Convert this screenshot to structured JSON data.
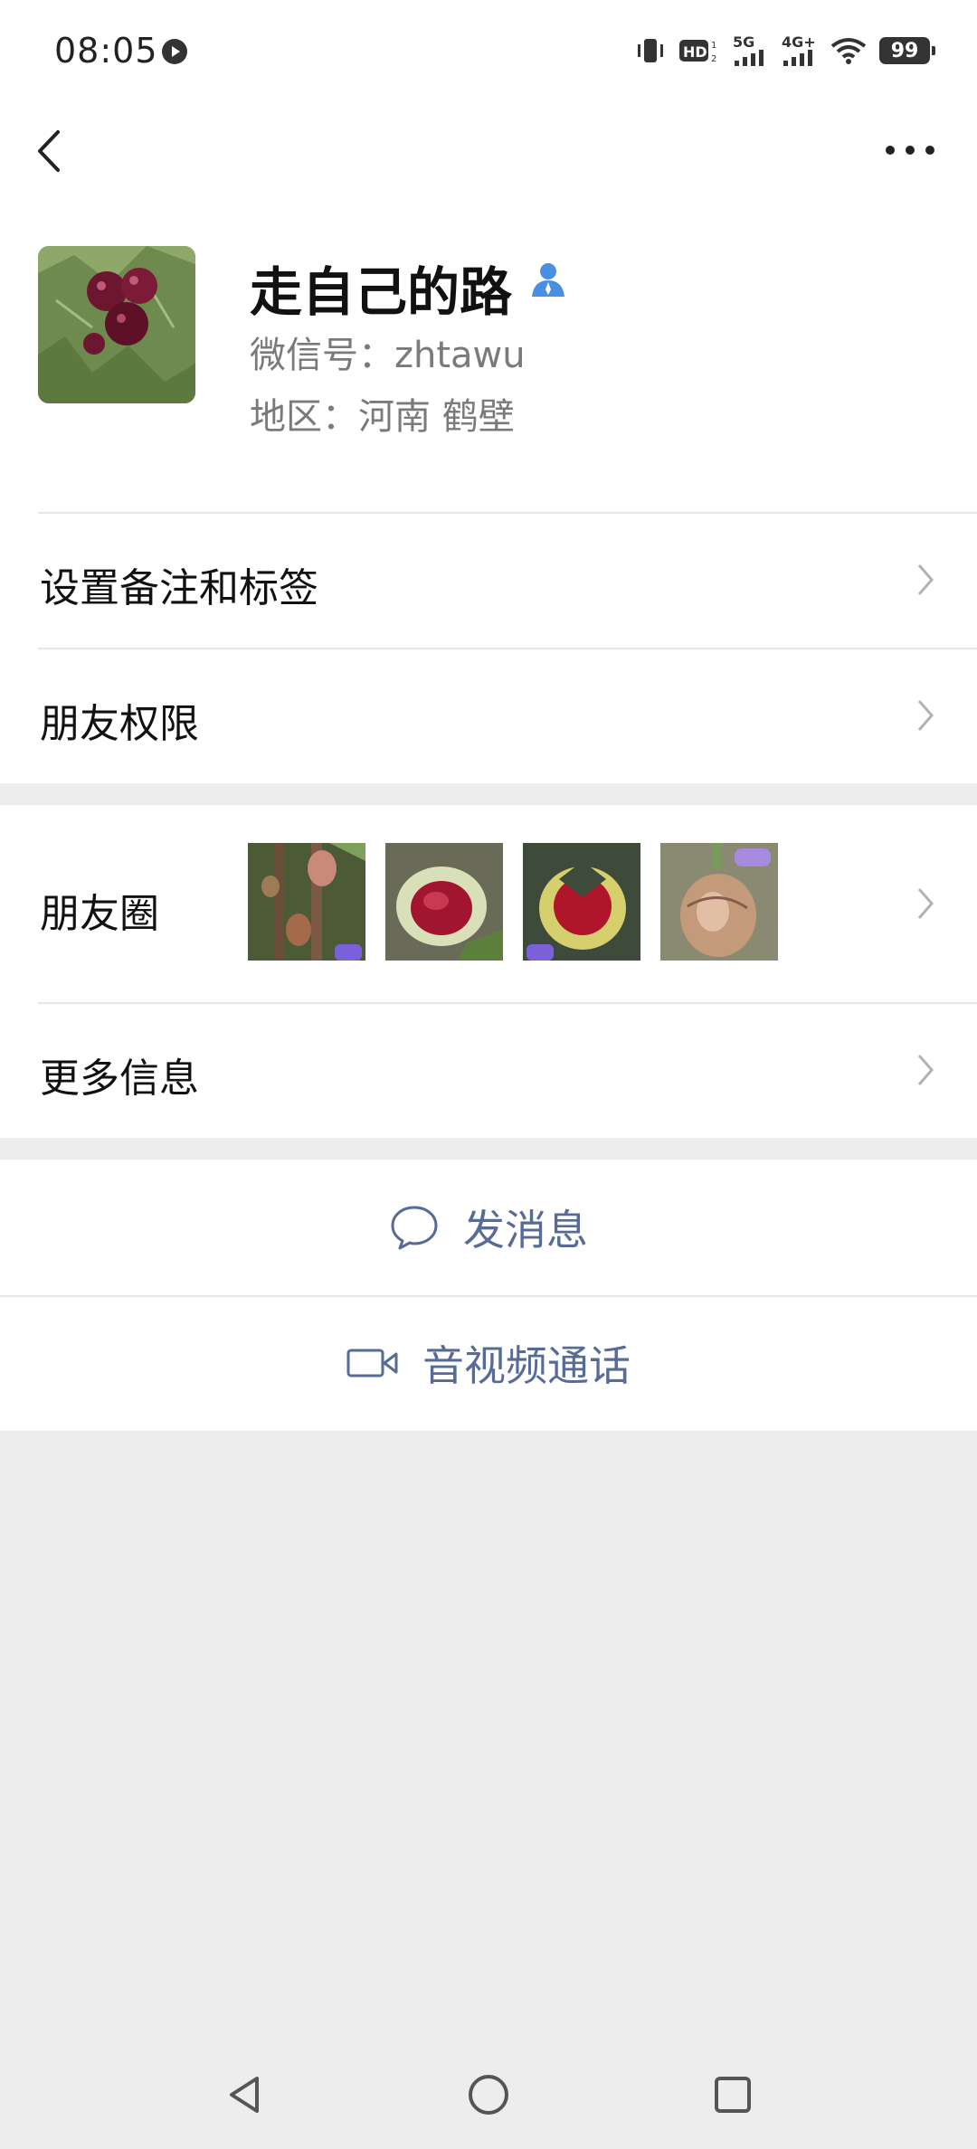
{
  "status_bar": {
    "time": "08:05",
    "network_1": "5G",
    "network_2": "4G+",
    "battery": "99"
  },
  "profile": {
    "nickname": "走自己的路",
    "wechat_id": "微信号：zhtawu",
    "region": "地区：河南  鹤壁"
  },
  "rows": {
    "remark_tags": "设置备注和标签",
    "permissions": "朋友权限",
    "moments": "朋友圈",
    "more_info": "更多信息"
  },
  "actions": {
    "send_message": "发消息",
    "video_call": "音视频通话"
  },
  "colors": {
    "link_blue": "#576b95",
    "background": "#ededed",
    "verified_person": "#4a90e2"
  },
  "icons": {
    "back": "chevron-left-icon",
    "more": "more-dots-icon",
    "chat": "chat-bubble-icon",
    "video": "video-camera-icon"
  }
}
